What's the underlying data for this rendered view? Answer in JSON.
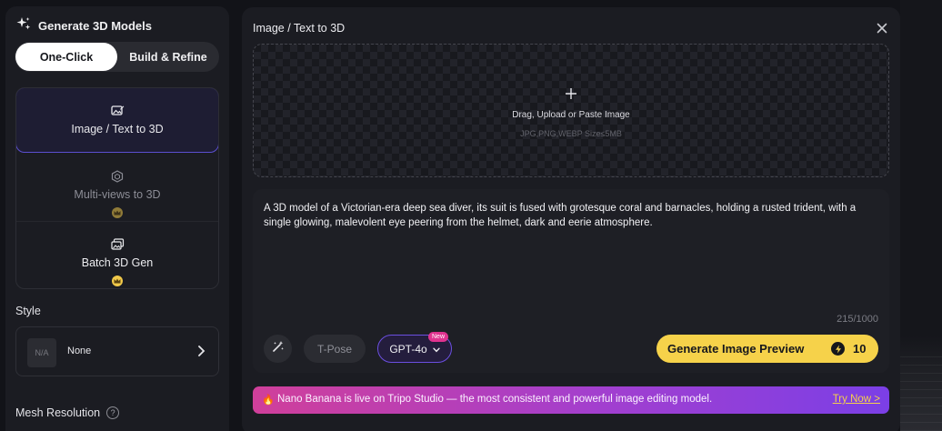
{
  "sidebar": {
    "header_title": "Generate 3D Models",
    "segment": {
      "active": "One-Click",
      "inactive": "Build & Refine"
    },
    "modes": [
      {
        "label": "Image / Text to 3D",
        "icon": "image-edit-icon",
        "active": true
      },
      {
        "label": "Multi-views to 3D",
        "icon": "cube-icon",
        "active": false,
        "premium": true
      },
      {
        "label": "Batch 3D Gen",
        "icon": "batch-images-icon",
        "active": false,
        "premium": true
      }
    ],
    "style": {
      "label": "Style",
      "thumb": "N/A",
      "value": "None"
    },
    "mesh_resolution": {
      "label": "Mesh Resolution",
      "help": "?"
    }
  },
  "main": {
    "title": "Image / Text to 3D",
    "dropzone": {
      "plus": "+",
      "text": "Drag, Upload or Paste Image",
      "subtext": "JPG,PNG,WEBP Size≤5MB"
    },
    "prompt": {
      "text": "A 3D model of a Victorian-era deep sea diver, its suit is fused with grotesque coral and barnacles, holding a rusted trident, with a single glowing, malevolent eye peering from the helmet, dark and eerie atmosphere.",
      "counter": "215/1000"
    },
    "tpose_label": "T-Pose",
    "model_select": {
      "value": "GPT-4o",
      "tag": "New"
    },
    "generate": {
      "label": "Generate Image Preview",
      "cost": "10"
    },
    "banner": {
      "emoji": "🔥",
      "message": "Nano Banana is live on Tripo Studio — the most consistent and powerful image editing model.",
      "cta": "Try Now >"
    }
  },
  "colors": {
    "accent_yellow": "#f6d24a",
    "accent_purple": "#6b4fe0",
    "banner_start": "#d03f9a",
    "banner_end": "#7b3fe6"
  }
}
